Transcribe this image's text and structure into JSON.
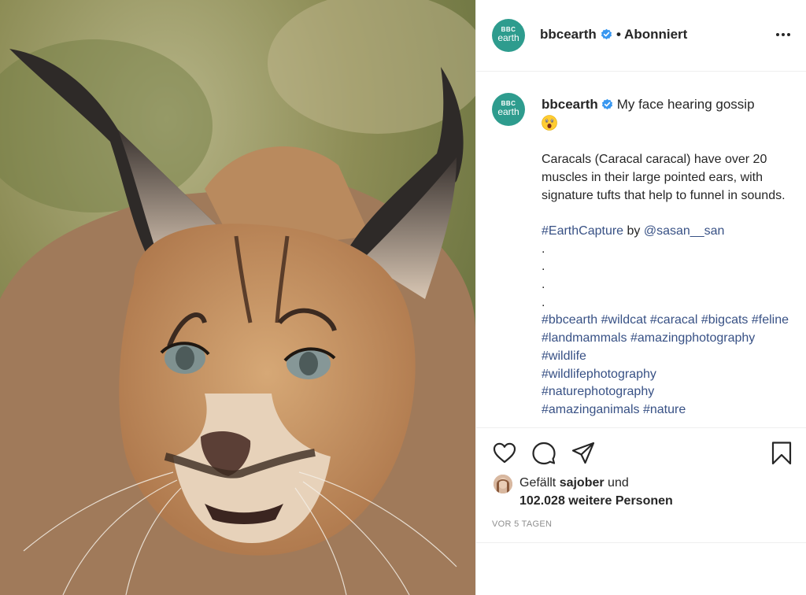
{
  "post": {
    "image_alt": "Caracal portrait",
    "account": {
      "username": "bbcearth",
      "avatar_line1": "BBC",
      "avatar_line2": "earth",
      "verified": true,
      "follow_status": "• Abonniert"
    },
    "caption": {
      "username": "bbcearth",
      "title": "My face hearing gossip",
      "emoji": "astonished-face",
      "body": "Caracals (Caracal caracal) have over 20 muscles in their large pointed ears, with signature tufts that help to funnel in sounds.",
      "capture_tag": "#EarthCapture",
      "by_text": " by ",
      "credit": "@sasan__san",
      "dots": [
        ".",
        ".",
        ".",
        "."
      ],
      "hashtags": [
        "#bbcearth",
        "#wildcat",
        "#caracal",
        "#bigcats",
        "#feline",
        "#landmammals",
        "#amazingphotography",
        "#wildlife",
        "#wildlifephotography",
        "#naturephotography",
        "#amazinganimals",
        "#nature"
      ]
    },
    "actions": {
      "like_icon": "heart-icon",
      "comment_icon": "comment-icon",
      "share_icon": "send-icon",
      "save_icon": "bookmark-icon"
    },
    "likes": {
      "prefix": "Gefällt ",
      "user": "sajober",
      "suffix": " und",
      "others": "102.028 weitere Personen"
    },
    "timestamp": "VOR 5 TAGEN"
  },
  "colors": {
    "brand_avatar": "#2e9c8e",
    "verified": "#3897f0",
    "link": "#385185",
    "muted": "#8e8e8e"
  }
}
